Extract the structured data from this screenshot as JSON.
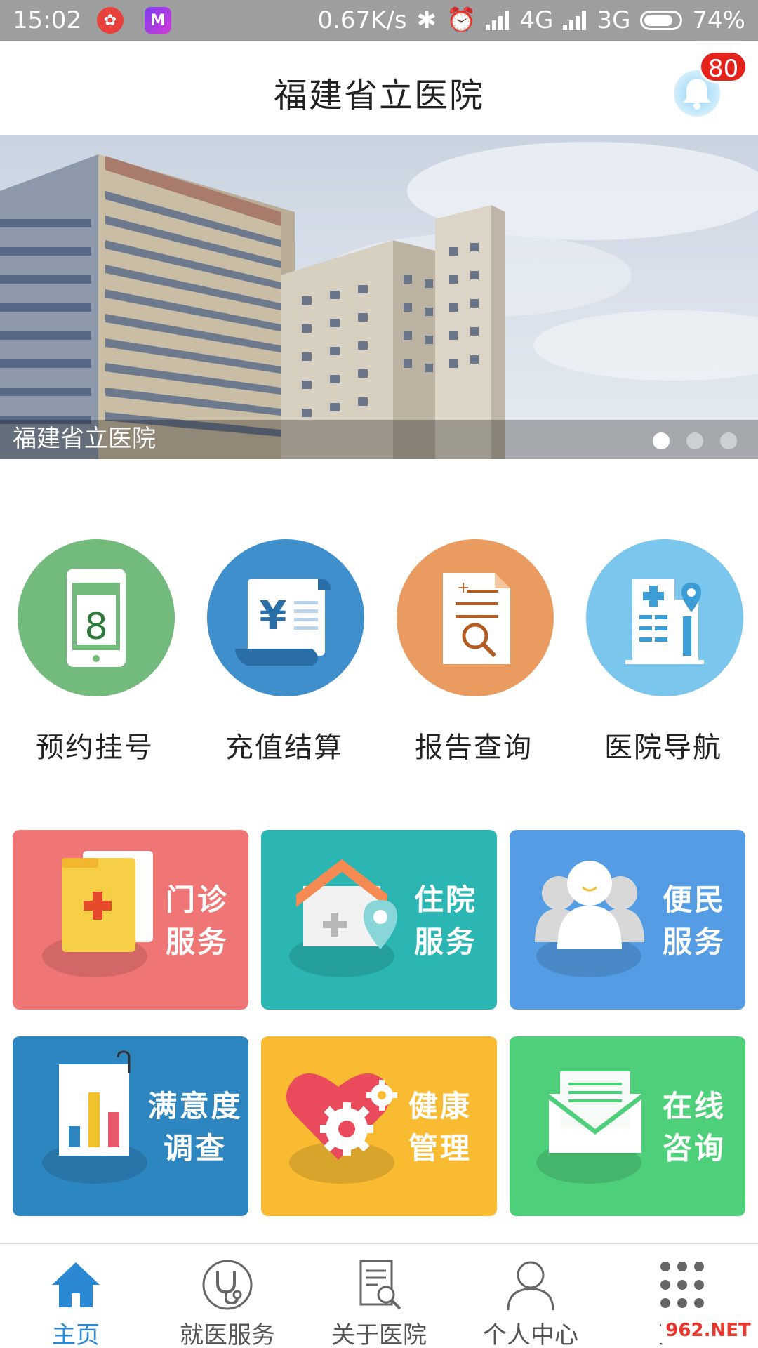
{
  "status_bar": {
    "time": "15:02",
    "network_speed": "0.67K/s",
    "network_4g": "4G",
    "network_3g": "3G",
    "battery": "74%",
    "icons": [
      "app-icon-red",
      "app-icon-m",
      "bluetooth-icon",
      "alarm-icon",
      "signal-icon",
      "signal-icon",
      "battery-icon"
    ]
  },
  "header": {
    "title": "福建省立医院",
    "notification_count": "80"
  },
  "banner": {
    "caption": "福建省立医院",
    "slide_count": 3,
    "active_slide": 1
  },
  "quick_actions": [
    {
      "label": "预约挂号",
      "icon": "phone-booking-icon",
      "color": "#72bb7d"
    },
    {
      "label": "充值结算",
      "icon": "yuan-receipt-icon",
      "color": "#3f8fcc"
    },
    {
      "label": "报告查询",
      "icon": "report-search-icon",
      "color": "#e99b60"
    },
    {
      "label": "医院导航",
      "icon": "hospital-location-icon",
      "color": "#7ac6ec"
    }
  ],
  "service_tiles": [
    {
      "line1": "门诊",
      "line2": "服务",
      "icon": "folder-medical-icon",
      "color": "#ef7674"
    },
    {
      "line1": "住院",
      "line2": "服务",
      "icon": "house-location-icon",
      "color": "#2bb6b3"
    },
    {
      "line1": "便民",
      "line2": "服务",
      "icon": "people-icon",
      "color": "#549de4"
    },
    {
      "line1": "满意度",
      "line2": "调查",
      "icon": "bar-chart-icon",
      "color": "#2e86c1"
    },
    {
      "line1": "健康",
      "line2": "管理",
      "icon": "heart-gear-icon",
      "color": "#f8bb31"
    },
    {
      "line1": "在线",
      "line2": "咨询",
      "icon": "envelope-icon",
      "color": "#4ecf7a"
    }
  ],
  "bottom_nav": [
    {
      "label": "主页",
      "icon": "home-icon",
      "active": true
    },
    {
      "label": "就医服务",
      "icon": "stethoscope-icon",
      "active": false
    },
    {
      "label": "关于医院",
      "icon": "document-search-icon",
      "active": false
    },
    {
      "label": "个人中心",
      "icon": "user-icon",
      "active": false
    },
    {
      "label": "更多",
      "icon": "grid-dots-icon",
      "active": false
    }
  ],
  "watermark": "962.NET",
  "colors": {
    "accent": "#2b89d4",
    "badge": "#e5211c",
    "status_bar": "#9e9e9e"
  }
}
